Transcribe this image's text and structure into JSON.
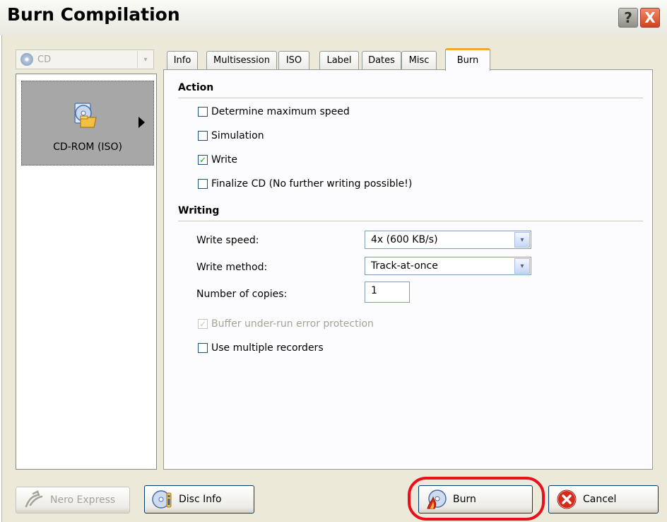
{
  "window": {
    "title": "Burn Compilation",
    "help_label": "?",
    "close_label": "X"
  },
  "left_pane": {
    "media_select": {
      "value": "CD"
    },
    "items": [
      {
        "label": "CD-ROM (ISO)",
        "icon": "cd-rom-iso-icon",
        "selected": true
      }
    ]
  },
  "tabs": [
    {
      "label": "Info",
      "active": false
    },
    {
      "label": "Multisession",
      "active": false
    },
    {
      "label": "ISO",
      "active": false
    },
    {
      "label": "Label",
      "active": false
    },
    {
      "label": "Dates",
      "active": false
    },
    {
      "label": "Misc",
      "active": false
    },
    {
      "label": "Burn",
      "active": true
    }
  ],
  "burn_tab": {
    "action": {
      "title": "Action",
      "options": [
        {
          "label": "Determine maximum speed",
          "checked": false
        },
        {
          "label": "Simulation",
          "checked": false
        },
        {
          "label": "Write",
          "checked": true
        },
        {
          "label": "Finalize CD (No further writing possible!)",
          "checked": false
        }
      ]
    },
    "writing": {
      "title": "Writing",
      "write_speed_label": "Write speed:",
      "write_speed_value": "4x (600 KB/s)",
      "write_method_label": "Write method:",
      "write_method_value": "Track-at-once",
      "copies_label": "Number of copies:",
      "copies_value": "1",
      "buffer_label": "Buffer under-run error protection",
      "buffer_checked": true,
      "buffer_enabled": false,
      "multiple_recorders_label": "Use multiple recorders",
      "multiple_recorders_checked": false
    }
  },
  "buttons": {
    "nero_express": "Nero Express",
    "disc_info": "Disc Info",
    "burn": "Burn",
    "cancel": "Cancel"
  },
  "colors": {
    "highlight": "#e8111b",
    "active_tab_accent": "#f4a92e",
    "dialog_bg": "#ece9d8"
  },
  "glyphs": {
    "check": "✓",
    "chevron": "▾"
  }
}
